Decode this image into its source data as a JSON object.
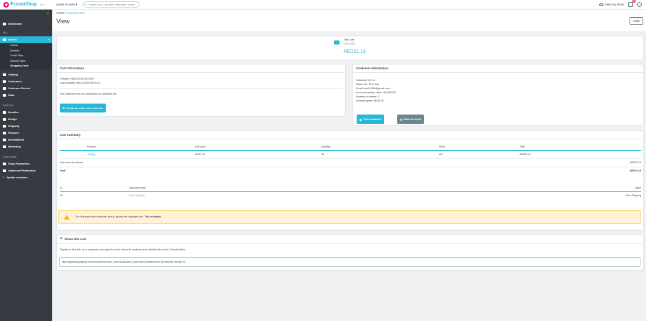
{
  "topbar": {
    "logo_name": "PrestaShop",
    "logo_version": "8.0.1",
    "quick_access": "Quick Access ▾",
    "search_placeholder": "Search (e.g.: product reference, custo",
    "view_store": "View my store",
    "notification_count": "10"
  },
  "sidebar": {
    "dashboard": "Dashboard",
    "section_sell": "SELL",
    "orders": "Orders",
    "orders_sub": [
      "Orders",
      "Invoices",
      "Credit Slips",
      "Delivery Slips",
      "Shopping Carts"
    ],
    "catalog": "Catalog",
    "customers": "Customers",
    "customer_service": "Customer Service",
    "stats": "Stats",
    "section_improve": "IMPROVE",
    "modules": "Modules",
    "design": "Design",
    "shipping": "Shipping",
    "payment": "Payment",
    "international": "International",
    "marketing": "Marketing",
    "section_configure": "CONFIGURE",
    "shop_parameters": "Shop Parameters",
    "advanced_parameters": "Advanced Parameters",
    "update_assistant": "Update assistant"
  },
  "header": {
    "breadcrumb_orders": "Orders",
    "breadcrumb_sep": "›",
    "breadcrumb_carts": "Shopping Carts",
    "title": "View",
    "help": "Help"
  },
  "cart_total": {
    "label": "Total cart",
    "cart_id": "CART #824",
    "amount": "AED21.19"
  },
  "cart_info": {
    "title": "Cart information",
    "created": "Created: 08/21/2025 08:19:47",
    "updated": "Last updated: 08/21/2025 08:20:20",
    "status": "The customer has not proceeded to checkout yet.",
    "create_order_btn": "Create an order from this cart"
  },
  "customer_info": {
    "title": "Customer information",
    "lines": [
      "Customer ID: 44",
      "Name: Mr. Test Test",
      "Email: test12345@gmail.com",
      "Account creation date: 11/14/2023",
      "Number of orders: 0",
      "Amount spent: AED0.00"
    ],
    "view_btn": "View customer",
    "email_btn": "Write an email"
  },
  "cart_summary": {
    "title": "Cart summary",
    "headers": [
      "Product",
      "Unit price",
      "Quantity",
      "Stock",
      "Total"
    ],
    "rows": [
      [
        "Testing",
        "AED1.10",
        "18",
        "2/2",
        "AED21.19"
      ]
    ],
    "total_products_label": "Total cost of products:",
    "total_products_value": "AED21.19",
    "total_label": "Total",
    "total_value": "AED21.19",
    "discount_headers": [
      "ID",
      "Discount name",
      "Value"
    ],
    "discount_rows": [
      [
        "18",
        "Free Shipping",
        "Free Shipping"
      ]
    ]
  },
  "warning": {
    "text": "For this particular customer group, prices are displayed as:",
    "bold": "Tax included"
  },
  "share": {
    "title": "Share this cart",
    "description": "Thanks to this link, your customer can open the cart, check its contents and validate the order, if it suits them.",
    "url": "http://pfpresta.paylinkt.com/en/cart?recover_cart=824&token_cart=96c149da54e19e7e27cb43827a61a076"
  },
  "colors": {
    "accent": "#25b9d7",
    "sidebar": "#363a41",
    "warning_bg": "#fff3d7"
  }
}
